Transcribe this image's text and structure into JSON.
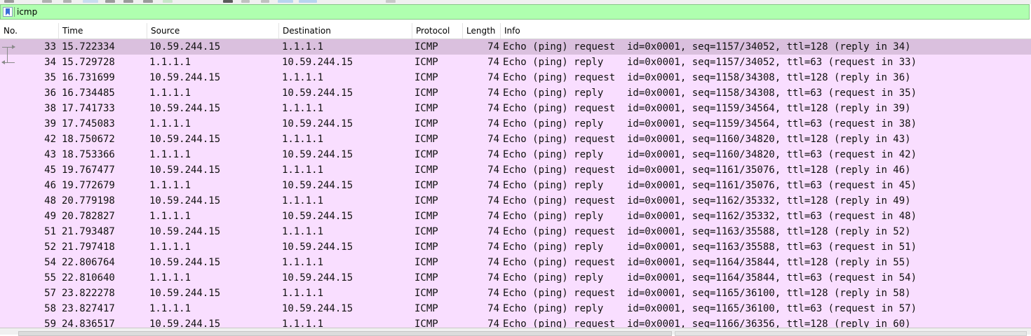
{
  "filter": {
    "value": "icmp"
  },
  "colors": {
    "filter_valid_bg": "#afffaf",
    "icmp_row_bg": "#f9deff",
    "selected_row_bg": "#dac0de"
  },
  "columns": [
    "No.",
    "Time",
    "Source",
    "Destination",
    "Protocol",
    "Length",
    "Info"
  ],
  "selected_packet": 33,
  "packets": [
    {
      "no": "33",
      "time": "15.722334",
      "src": "10.59.244.15",
      "dst": "1.1.1.1",
      "proto": "ICMP",
      "len": "74",
      "info": "Echo (ping) request  id=0x0001, seq=1157/34052, ttl=128 (reply in 34)"
    },
    {
      "no": "34",
      "time": "15.729728",
      "src": "1.1.1.1",
      "dst": "10.59.244.15",
      "proto": "ICMP",
      "len": "74",
      "info": "Echo (ping) reply    id=0x0001, seq=1157/34052, ttl=63 (request in 33)"
    },
    {
      "no": "35",
      "time": "16.731699",
      "src": "10.59.244.15",
      "dst": "1.1.1.1",
      "proto": "ICMP",
      "len": "74",
      "info": "Echo (ping) request  id=0x0001, seq=1158/34308, ttl=128 (reply in 36)"
    },
    {
      "no": "36",
      "time": "16.734485",
      "src": "1.1.1.1",
      "dst": "10.59.244.15",
      "proto": "ICMP",
      "len": "74",
      "info": "Echo (ping) reply    id=0x0001, seq=1158/34308, ttl=63 (request in 35)"
    },
    {
      "no": "38",
      "time": "17.741733",
      "src": "10.59.244.15",
      "dst": "1.1.1.1",
      "proto": "ICMP",
      "len": "74",
      "info": "Echo (ping) request  id=0x0001, seq=1159/34564, ttl=128 (reply in 39)"
    },
    {
      "no": "39",
      "time": "17.745083",
      "src": "1.1.1.1",
      "dst": "10.59.244.15",
      "proto": "ICMP",
      "len": "74",
      "info": "Echo (ping) reply    id=0x0001, seq=1159/34564, ttl=63 (request in 38)"
    },
    {
      "no": "42",
      "time": "18.750672",
      "src": "10.59.244.15",
      "dst": "1.1.1.1",
      "proto": "ICMP",
      "len": "74",
      "info": "Echo (ping) request  id=0x0001, seq=1160/34820, ttl=128 (reply in 43)"
    },
    {
      "no": "43",
      "time": "18.753366",
      "src": "1.1.1.1",
      "dst": "10.59.244.15",
      "proto": "ICMP",
      "len": "74",
      "info": "Echo (ping) reply    id=0x0001, seq=1160/34820, ttl=63 (request in 42)"
    },
    {
      "no": "45",
      "time": "19.767477",
      "src": "10.59.244.15",
      "dst": "1.1.1.1",
      "proto": "ICMP",
      "len": "74",
      "info": "Echo (ping) request  id=0x0001, seq=1161/35076, ttl=128 (reply in 46)"
    },
    {
      "no": "46",
      "time": "19.772679",
      "src": "1.1.1.1",
      "dst": "10.59.244.15",
      "proto": "ICMP",
      "len": "74",
      "info": "Echo (ping) reply    id=0x0001, seq=1161/35076, ttl=63 (request in 45)"
    },
    {
      "no": "48",
      "time": "20.779198",
      "src": "10.59.244.15",
      "dst": "1.1.1.1",
      "proto": "ICMP",
      "len": "74",
      "info": "Echo (ping) request  id=0x0001, seq=1162/35332, ttl=128 (reply in 49)"
    },
    {
      "no": "49",
      "time": "20.782827",
      "src": "1.1.1.1",
      "dst": "10.59.244.15",
      "proto": "ICMP",
      "len": "74",
      "info": "Echo (ping) reply    id=0x0001, seq=1162/35332, ttl=63 (request in 48)"
    },
    {
      "no": "51",
      "time": "21.793487",
      "src": "10.59.244.15",
      "dst": "1.1.1.1",
      "proto": "ICMP",
      "len": "74",
      "info": "Echo (ping) request  id=0x0001, seq=1163/35588, ttl=128 (reply in 52)"
    },
    {
      "no": "52",
      "time": "21.797418",
      "src": "1.1.1.1",
      "dst": "10.59.244.15",
      "proto": "ICMP",
      "len": "74",
      "info": "Echo (ping) reply    id=0x0001, seq=1163/35588, ttl=63 (request in 51)"
    },
    {
      "no": "54",
      "time": "22.806764",
      "src": "10.59.244.15",
      "dst": "1.1.1.1",
      "proto": "ICMP",
      "len": "74",
      "info": "Echo (ping) request  id=0x0001, seq=1164/35844, ttl=128 (reply in 55)"
    },
    {
      "no": "55",
      "time": "22.810640",
      "src": "1.1.1.1",
      "dst": "10.59.244.15",
      "proto": "ICMP",
      "len": "74",
      "info": "Echo (ping) reply    id=0x0001, seq=1164/35844, ttl=63 (request in 54)"
    },
    {
      "no": "57",
      "time": "23.822278",
      "src": "10.59.244.15",
      "dst": "1.1.1.1",
      "proto": "ICMP",
      "len": "74",
      "info": "Echo (ping) request  id=0x0001, seq=1165/36100, ttl=128 (reply in 58)"
    },
    {
      "no": "58",
      "time": "23.827417",
      "src": "1.1.1.1",
      "dst": "10.59.244.15",
      "proto": "ICMP",
      "len": "74",
      "info": "Echo (ping) reply    id=0x0001, seq=1165/36100, ttl=63 (request in 57)"
    },
    {
      "no": "59",
      "time": "24.836517",
      "src": "10.59.244.15",
      "dst": "1.1.1.1",
      "proto": "ICMP",
      "len": "74",
      "info": "Echo (ping) request  id=0x0001, seq=1166/36356, ttl=128 (reply in 60)"
    }
  ]
}
